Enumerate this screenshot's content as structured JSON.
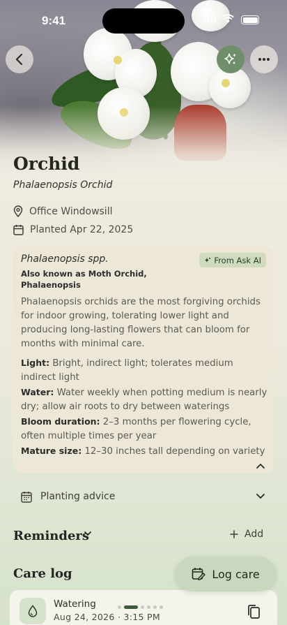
{
  "status_bar": {
    "time": "9:41"
  },
  "hero": {
    "image_description_icon": "orchid-photo"
  },
  "buttons": {
    "back": "back-icon",
    "ai": "sparkles-icon",
    "more": "more-icon"
  },
  "plant": {
    "name": "Orchid",
    "common_name": "Phalaenopsis Orchid",
    "location": "Office Windowsill",
    "planted": "Planted Apr 22, 2025"
  },
  "ai_card": {
    "scientific_name": "Phalaenopsis spp.",
    "aka": "Also known as Moth Orchid, Phalaenopsis",
    "badge": "From Ask AI",
    "description": "Phalaenopsis orchids are the most forgiving orchids for indoor growing, tolerating lower light and producing long-lasting flowers that can bloom for months with minimal care.",
    "facts": [
      {
        "label": "Light:",
        "value": "Bright, indirect light; tolerates medium indirect light"
      },
      {
        "label": "Water:",
        "value": "Water weekly when potting medium is nearly dry; allow air roots to dry between waterings"
      },
      {
        "label": "Bloom duration:",
        "value": "2–3 months per flowering cycle, often multiple times per year"
      },
      {
        "label": "Mature size:",
        "value": "12–30 inches tall depending on variety"
      }
    ]
  },
  "planting_advice": {
    "label": "Planting advice"
  },
  "reminders": {
    "title": "Reminders",
    "add_label": "Add"
  },
  "care_log": {
    "title": "Care log",
    "log_care_label": "Log care",
    "entries": [
      {
        "type": "Watering",
        "date": "Aug 24, 2026 · 3:15 PM"
      }
    ],
    "pager": {
      "count": 6,
      "active": 0
    }
  },
  "colors": {
    "accent": "#6f8f6a",
    "badge_bg": "#cfdbbf",
    "fab_bg": "#c9d7be"
  }
}
